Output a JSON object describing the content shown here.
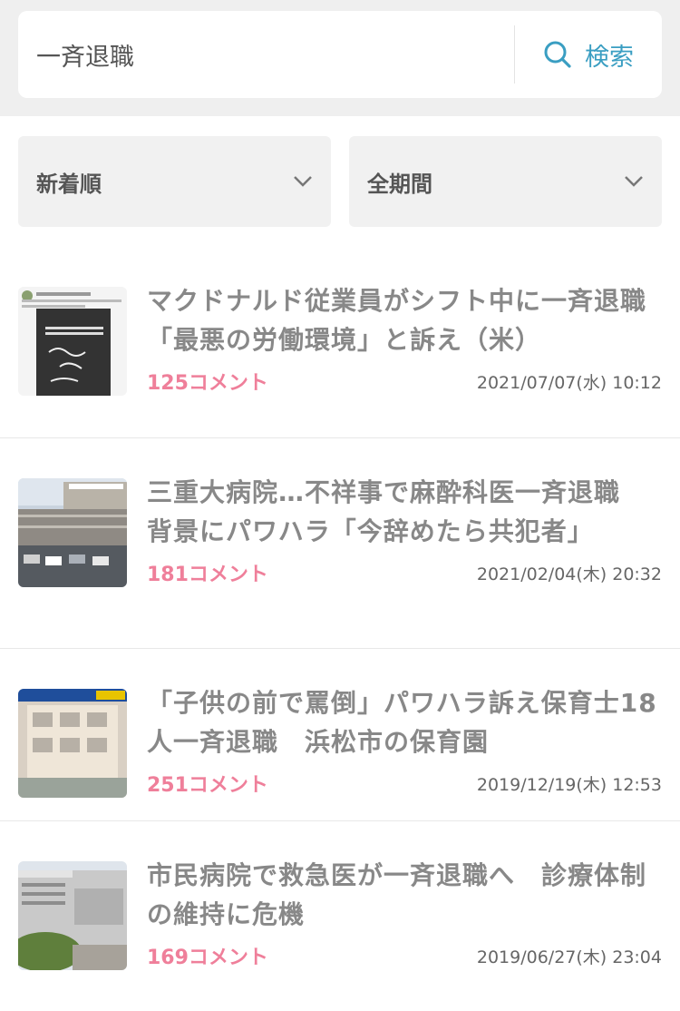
{
  "search": {
    "query": "一斉退職",
    "button_label": "検索",
    "icon": "search-icon",
    "accent": "#3a9ec2"
  },
  "filters": {
    "sort": {
      "selected": "新着順",
      "icon": "chevron-down-icon"
    },
    "period": {
      "selected": "全期間",
      "icon": "chevron-down-icon"
    }
  },
  "articles": [
    {
      "title": "マクドナルド従業員がシフト中に一斉退職　「最悪の労働環境」と訴え（米）",
      "comments": "125コメント",
      "date": "2021/07/07(水) 10:12"
    },
    {
      "title": "三重大病院…不祥事で麻酔科医一斉退職　背景にパワハラ「今辞めたら共犯者」",
      "comments": "181コメント",
      "date": "2021/02/04(木) 20:32"
    },
    {
      "title": "「子供の前で罵倒」パワハラ訴え保育士18人一斉退職　浜松市の保育園",
      "comments": "251コメント",
      "date": "2019/12/19(木) 12:53"
    },
    {
      "title": "市民病院で救急医が一斉退職へ　診療体制の維持に危機",
      "comments": "169コメント",
      "date": "2019/06/27(木) 23:04"
    }
  ],
  "colors": {
    "comment": "#ef7f9a",
    "title": "#888888",
    "background_band": "#efefef"
  }
}
